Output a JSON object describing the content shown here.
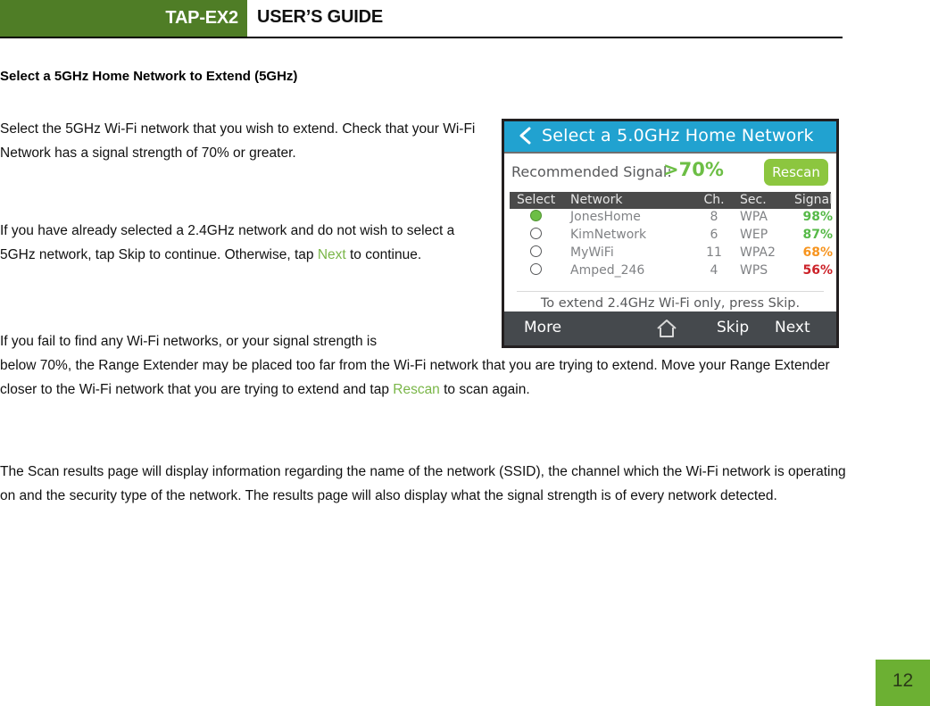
{
  "header": {
    "brand": "TAP-EX2",
    "title": "USER’S GUIDE"
  },
  "document": {
    "section_heading": "Select a 5GHz Home Network to Extend (5GHz)",
    "paragraph_1": "Select the 5GHz Wi-Fi network that you wish to extend.  Check that your Wi-Fi Network has a signal strength of 70% or greater.",
    "paragraph_2_part1": "If you have already selected a 2.4GHz network and do not wish to select a 5GHz network, tap Skip to continue.  Otherwise, tap ",
    "paragraph_2_link": "Next",
    "paragraph_2_part2": " to continue.",
    "paragraph_3_line1": "If you fail to find any Wi-Fi networks, or your signal strength is ",
    "paragraph_3_part1": "below 70%, the Range Extender may be placed too far from the Wi-Fi network that you are trying to extend. Move your Range Extender closer to the Wi-Fi network that you are trying to extend and tap ",
    "paragraph_3_link": "Rescan",
    "paragraph_3_part2": " to scan again.",
    "paragraph_4": "The Scan results page will display information regarding the name of the network (SSID), the channel which the Wi-Fi network is operating on and the security type of the network. The results page will also display what the signal strength is of every network detected.",
    "page_number": "12"
  },
  "device_screen": {
    "back_icon": "chevron-left-icon",
    "title": "Select a 5.0GHz Home Network",
    "recommended_label": "Recommended Signal:",
    "recommended_value": ">70%",
    "rescan_button": "Rescan",
    "table": {
      "columns": [
        "Select",
        "Network",
        "Ch.",
        "Sec.",
        "Signal"
      ],
      "rows": [
        {
          "selected": true,
          "network": "JonesHome",
          "ch": "8",
          "sec": "WPA",
          "signal": "98%",
          "signal_color": "#56b948"
        },
        {
          "selected": false,
          "network": "KimNetwork",
          "ch": "6",
          "sec": "WEP",
          "signal": "87%",
          "signal_color": "#56b948"
        },
        {
          "selected": false,
          "network": "MyWiFi",
          "ch": "11",
          "sec": "WPA2",
          "signal": "68%",
          "signal_color": "#f7941e"
        },
        {
          "selected": false,
          "network": "Amped_246",
          "ch": "4",
          "sec": "WPS",
          "signal": "56%",
          "signal_color": "#cc2229"
        }
      ]
    },
    "hint": "To extend 2.4GHz Wi-Fi only, press Skip.",
    "footer": {
      "more": "More",
      "home_icon": "home-icon",
      "skip": "Skip",
      "next": "Next"
    }
  },
  "colors": {
    "header_green": "#4f7d26",
    "link_green": "#7ab648",
    "page_badge_green": "#6cb033",
    "device_titlebar_blue": "#21a2d0",
    "rescan_green": "#8cc63f"
  }
}
